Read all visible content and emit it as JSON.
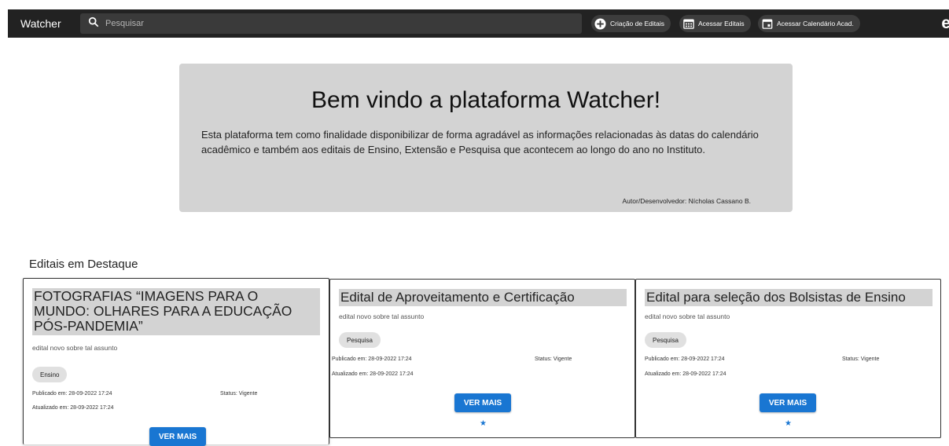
{
  "header": {
    "brand": "Watcher",
    "search_placeholder": "Pesquisar",
    "buttons": [
      {
        "label": "Criação de Editais",
        "icon": "add-circle-icon"
      },
      {
        "label": "Acessar Editais",
        "icon": "calendar-grid-icon"
      },
      {
        "label": "Acessar Calendário Acad.",
        "icon": "calendar-event-icon"
      }
    ],
    "user_glyph": "e"
  },
  "welcome": {
    "title": "Bem vindo a plataforma Watcher!",
    "description": "Esta plataforma tem como finalidade disponibilizar de forma agradável as informações relacionadas às datas do calendário acadêmico e também aos editais de Ensino, Extensão e Pesquisa que acontecem ao longo do ano no Instituto.",
    "author": "Autor/Desenvolvedor: Nícholas Cassano B."
  },
  "featured": {
    "title": "Editais em Destaque",
    "cards": [
      {
        "title": "FOTOGRAFIAS “IMAGENS PARA O MUNDO: OLHARES PARA A EDUCAÇÃO PÓS-PANDEMIA”",
        "subtitle": "edital novo sobre tal assunto",
        "tag": "Ensino",
        "published": "Publicado em: 28-09-2022 17:24",
        "updated": "Atualizado em: 28-09-2022 17:24",
        "status": "Status: Vigente",
        "button": "VER MAIS"
      },
      {
        "title": "Edital de Aproveitamento e Certificação",
        "subtitle": "edital novo sobre tal assunto",
        "tag": "Pesquisa",
        "published": "Publicado em: 28-09-2022 17:24",
        "updated": "Atualizado em: 28-09-2022 17:24",
        "status": "Status: Vigente",
        "button": "VER MAIS"
      },
      {
        "title": "Edital para seleção dos Bolsistas de Ensino",
        "subtitle": "edital novo sobre tal assunto",
        "tag": "Pesquisa",
        "published": "Publicado em: 28-09-2022 17:24",
        "updated": "Atualizado em: 28-09-2022 17:24",
        "status": "Status: Vigente",
        "button": "VER MAIS"
      }
    ]
  },
  "colors": {
    "topbar": "#222222",
    "panel": "#d3d3d3",
    "primary": "#1976d2"
  }
}
